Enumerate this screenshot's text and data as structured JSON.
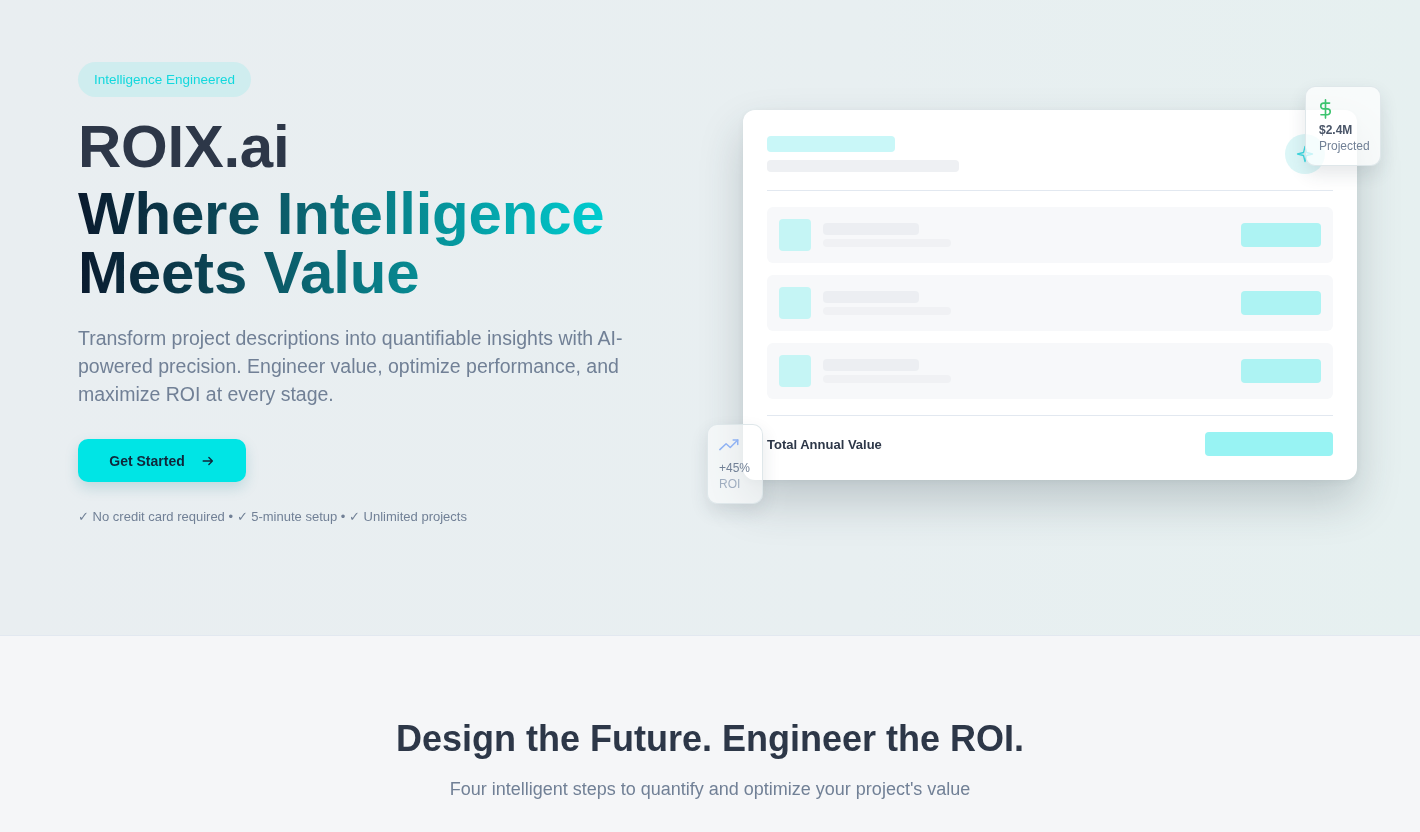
{
  "hero": {
    "tag": "Intelligence Engineered",
    "brand": "ROIX.ai",
    "headline": "Where Intelligence Meets Value",
    "description": "Transform project descriptions into quantifiable insights with AI-powered precision. Engineer value, optimize performance, and maximize ROI at every stage.",
    "cta": {
      "label": "Get Started"
    },
    "perks_note": "✓ No credit card required • ✓ 5-minute setup • ✓ Unlimited projects"
  },
  "preview": {
    "total_label": "Total Annual Value",
    "stat_cards": [
      {
        "kind": "money",
        "value": "$2.4M",
        "caption": "Projected"
      },
      {
        "kind": "trend",
        "value": "+45%",
        "caption": "ROI"
      }
    ]
  },
  "features": {
    "title": "Design the Future. Engineer the ROI.",
    "subtitle": "Four intelligent steps to quantify and optimize your project's value"
  }
}
